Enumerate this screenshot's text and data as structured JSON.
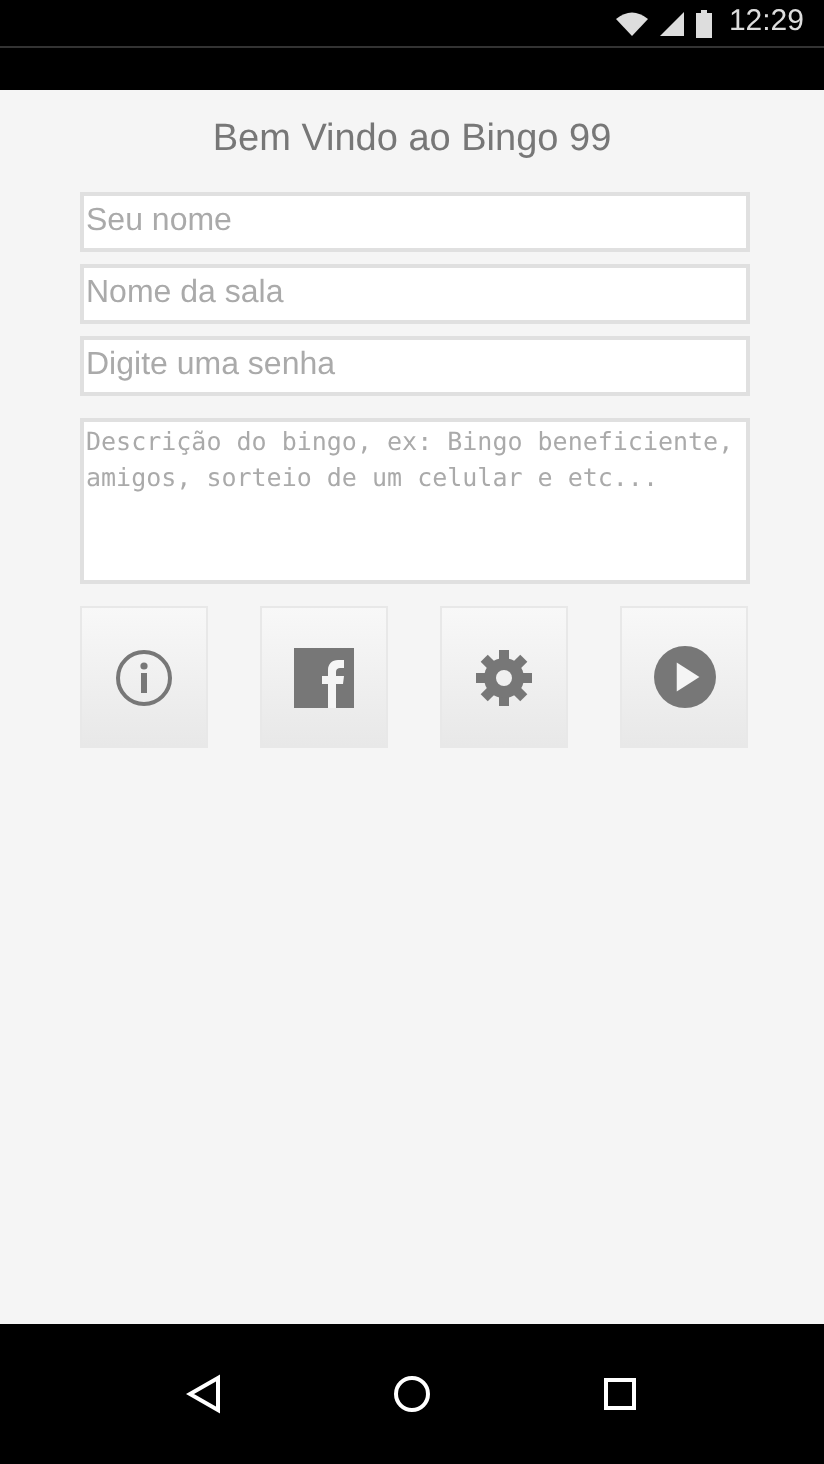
{
  "status_bar": {
    "time": "12:29"
  },
  "title": "Bem Vindo ao Bingo 99",
  "fields": [
    {
      "placeholder": "Seu nome"
    },
    {
      "placeholder": "Nome da sala"
    },
    {
      "placeholder": "Digite uma senha"
    }
  ],
  "description": {
    "placeholder": "Descrição do bingo, ex: Bingo beneficiente, amigos, sorteio de um celular e etc..."
  },
  "actions": [
    {
      "kind": "info"
    },
    {
      "kind": "facebook"
    },
    {
      "kind": "settings"
    },
    {
      "kind": "play"
    }
  ]
}
